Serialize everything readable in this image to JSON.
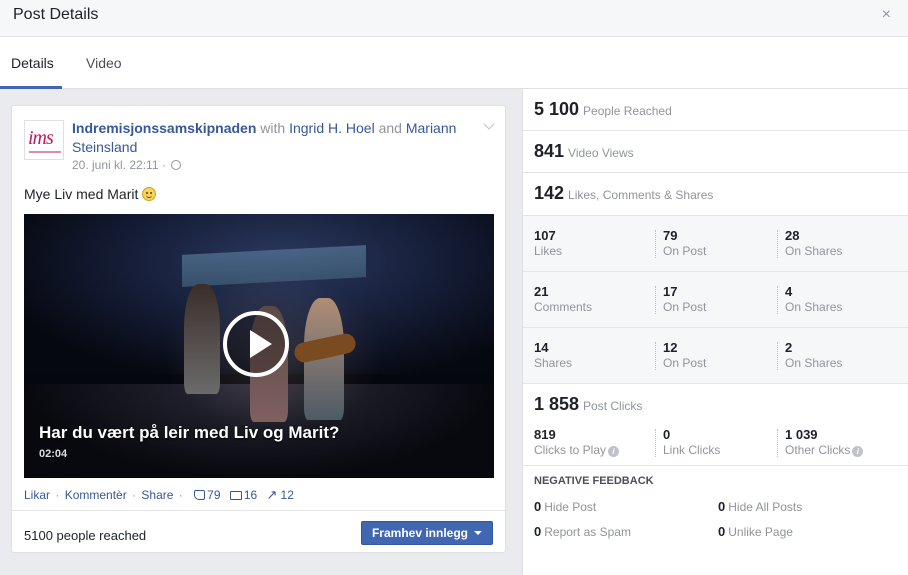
{
  "dialog": {
    "title": "Post Details",
    "close_glyph": "×"
  },
  "tabs": [
    {
      "label": "Details",
      "active": true
    },
    {
      "label": "Video",
      "active": false
    }
  ],
  "post": {
    "page_name": "Indremisjonssamskipnaden",
    "with_word": "with",
    "tag1": "Ingrid H. Hoel",
    "and_word": "and",
    "tag2": "Mariann Steinsland",
    "timestamp": "20. juni kl. 22:11",
    "meta_sep": "·",
    "text": "Mye Liv med Marit",
    "avatar_text": "ims",
    "video": {
      "title": "Har du vært på leir med Liv og Marit?",
      "duration": "02:04"
    },
    "actions": {
      "like": "Likar",
      "comment": "Kommentèr",
      "share": "Share",
      "sep": "·"
    },
    "counts": {
      "likes": "79",
      "comments": "16",
      "shares": "12"
    },
    "reached": "5100 people reached",
    "boost_label": "Framhev innlegg"
  },
  "stats": {
    "people_reached": {
      "num": "5 100",
      "label": "People Reached"
    },
    "video_views": {
      "num": "841",
      "label": "Video Views"
    },
    "engagement": {
      "num": "142",
      "label": "Likes, Comments & Shares"
    },
    "rows": [
      [
        {
          "v": "107",
          "l": "Likes"
        },
        {
          "v": "79",
          "l": "On Post"
        },
        {
          "v": "28",
          "l": "On Shares"
        }
      ],
      [
        {
          "v": "21",
          "l": "Comments"
        },
        {
          "v": "17",
          "l": "On Post"
        },
        {
          "v": "4",
          "l": "On Shares"
        }
      ],
      [
        {
          "v": "14",
          "l": "Shares"
        },
        {
          "v": "12",
          "l": "On Post"
        },
        {
          "v": "2",
          "l": "On Shares"
        }
      ]
    ],
    "post_clicks": {
      "num": "1 858",
      "label": "Post Clicks"
    },
    "clicks": [
      {
        "v": "819",
        "l": "Clicks to Play"
      },
      {
        "v": "0",
        "l": "Link Clicks"
      },
      {
        "v": "1 039",
        "l": "Other Clicks"
      }
    ],
    "info_glyph": "i",
    "negative": {
      "title": "NEGATIVE FEEDBACK",
      "items": [
        {
          "v": "0",
          "l": "Hide Post"
        },
        {
          "v": "0",
          "l": "Hide All Posts"
        },
        {
          "v": "0",
          "l": "Report as Spam"
        },
        {
          "v": "0",
          "l": "Unlike Page"
        }
      ]
    }
  },
  "colors": {
    "accent": "#4267b2",
    "link": "#365899",
    "muted": "#90949c"
  },
  "icons": [
    "close-icon",
    "chevron-down-icon",
    "globe-icon",
    "smiley-icon",
    "play-icon",
    "like-icon",
    "comment-icon",
    "share-icon",
    "info-icon"
  ]
}
